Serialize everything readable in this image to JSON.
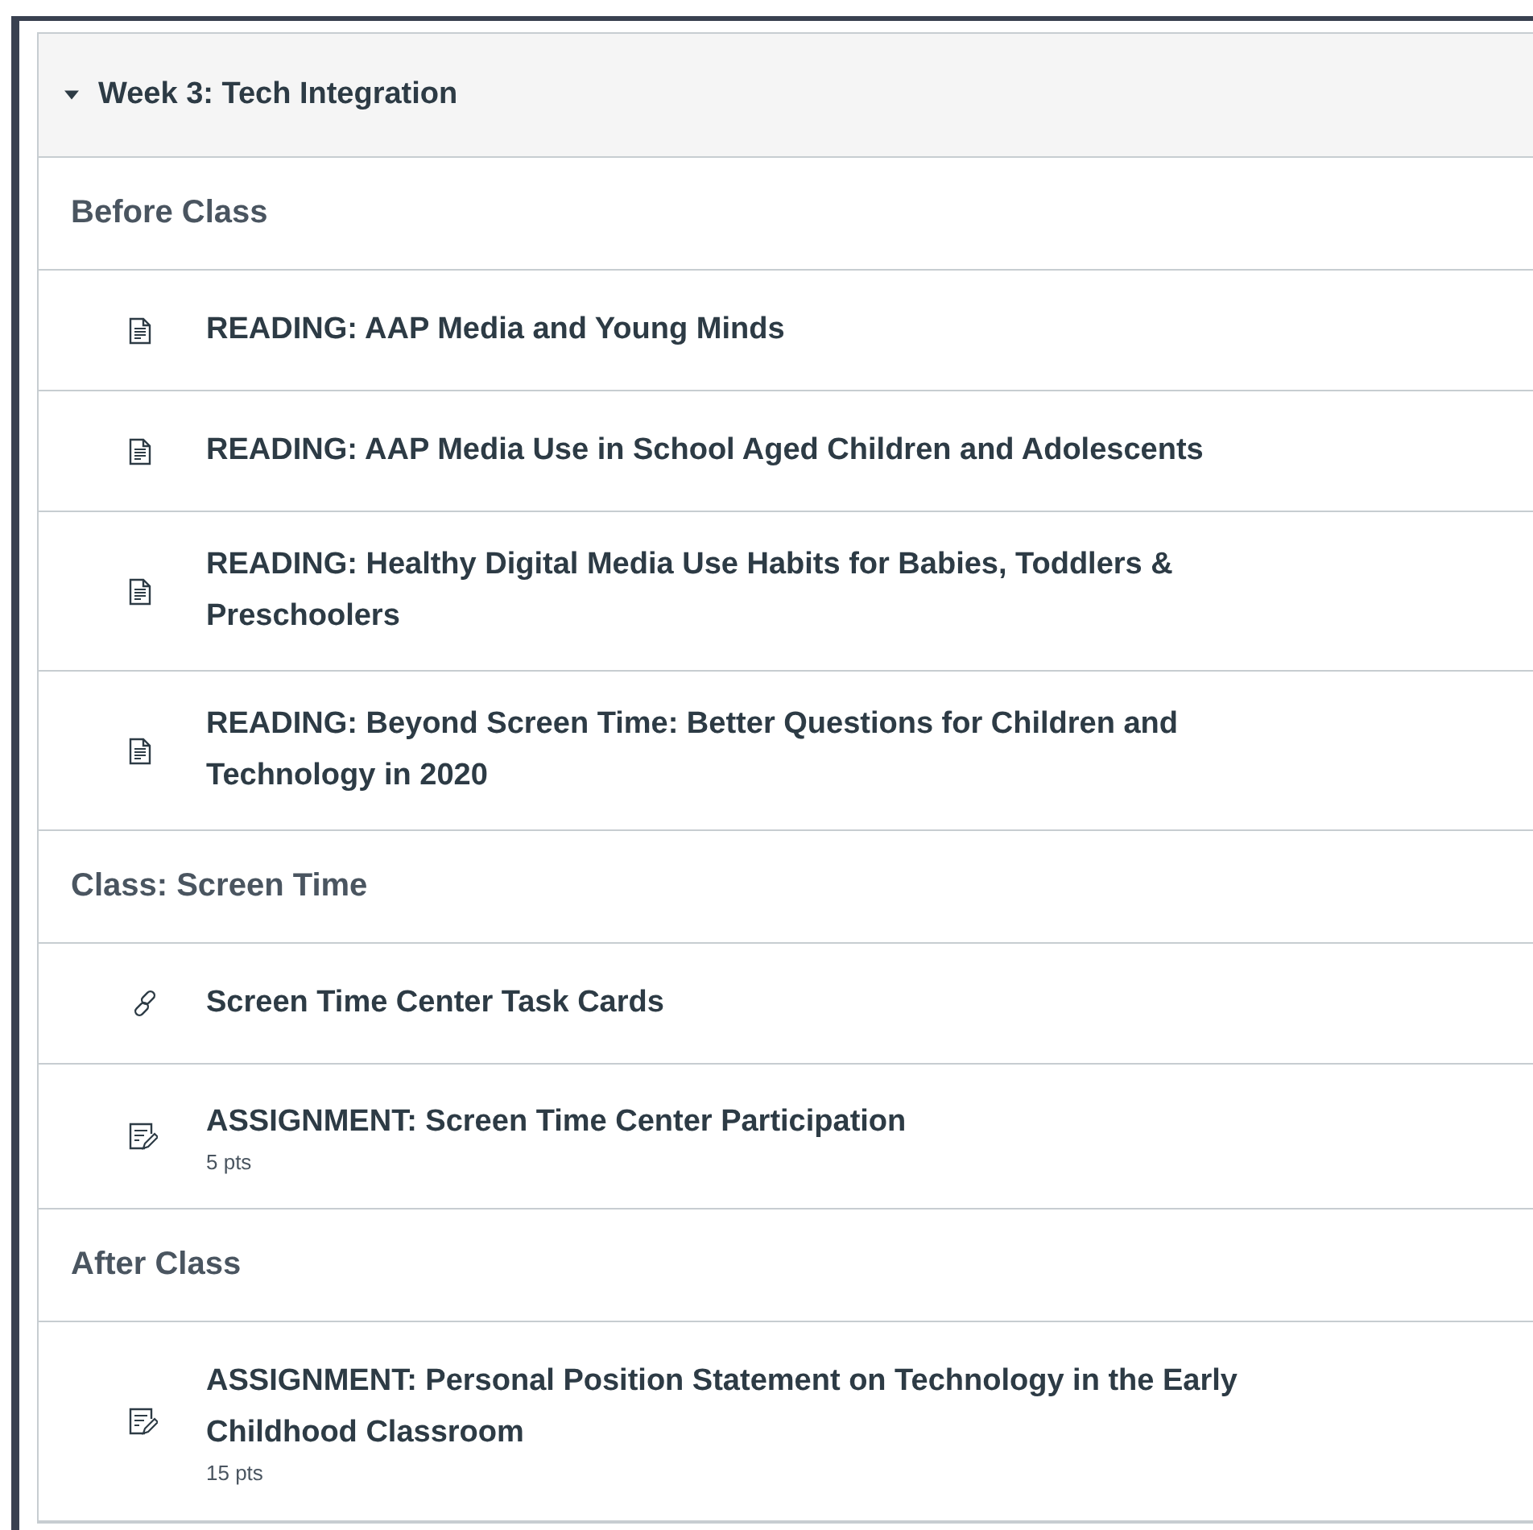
{
  "module": {
    "title": "Week 3: Tech Integration",
    "expanded": true
  },
  "items": [
    {
      "kind": "header",
      "title": "Before Class"
    },
    {
      "kind": "page",
      "title": "READING: AAP Media and Young Minds"
    },
    {
      "kind": "page",
      "title": "READING: AAP Media Use in School Aged Children and Adolescents"
    },
    {
      "kind": "page",
      "title": "READING: Healthy Digital Media Use Habits for Babies, Toddlers & Preschoolers"
    },
    {
      "kind": "page",
      "title": "READING: Beyond Screen Time: Better Questions for Children and Technology in 2020"
    },
    {
      "kind": "header",
      "title": "Class: Screen Time"
    },
    {
      "kind": "link",
      "title": "Screen Time Center Task Cards"
    },
    {
      "kind": "assignment",
      "title": "ASSIGNMENT: Screen Time Center Participation",
      "points": "5 pts"
    },
    {
      "kind": "header",
      "title": "After Class"
    },
    {
      "kind": "assignment",
      "title": "ASSIGNMENT: Personal Position Statement on Technology in the Early Childhood Classroom",
      "points": "15 pts"
    }
  ]
}
